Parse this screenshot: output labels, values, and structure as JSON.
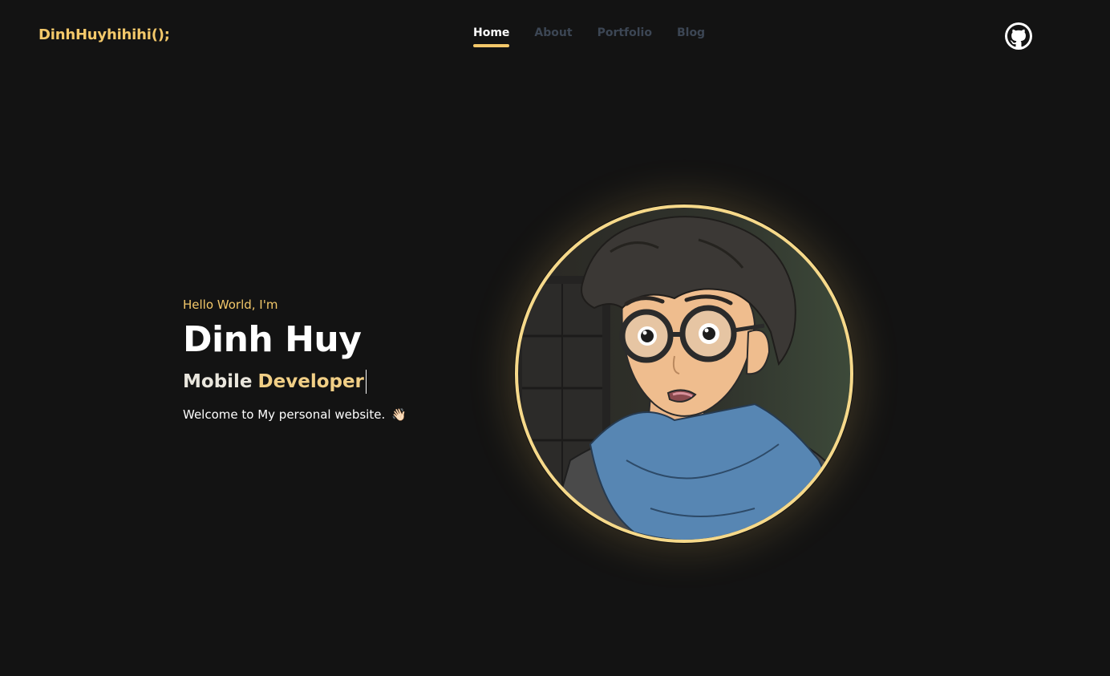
{
  "brand": {
    "text": "DinhHuyhihihi();"
  },
  "nav": {
    "items": [
      {
        "label": "Home",
        "active": true
      },
      {
        "label": "About",
        "active": false
      },
      {
        "label": "Portfolio",
        "active": false
      },
      {
        "label": "Blog",
        "active": false
      }
    ]
  },
  "header": {
    "github_icon": "github-icon"
  },
  "hero": {
    "greeting": "Hello World, I'm",
    "name": "Dinh Huy",
    "role_prefix": "Mobile",
    "role_word": "Developer",
    "welcome": "Welcome to My personal website.",
    "wave_emoji": "👋🏻"
  },
  "avatar": {
    "icon": "avatar-illustration"
  },
  "colors": {
    "background": "#131313",
    "accent": "#f3c86a",
    "nav_inactive": "#3c4654",
    "text": "#ffffff"
  }
}
